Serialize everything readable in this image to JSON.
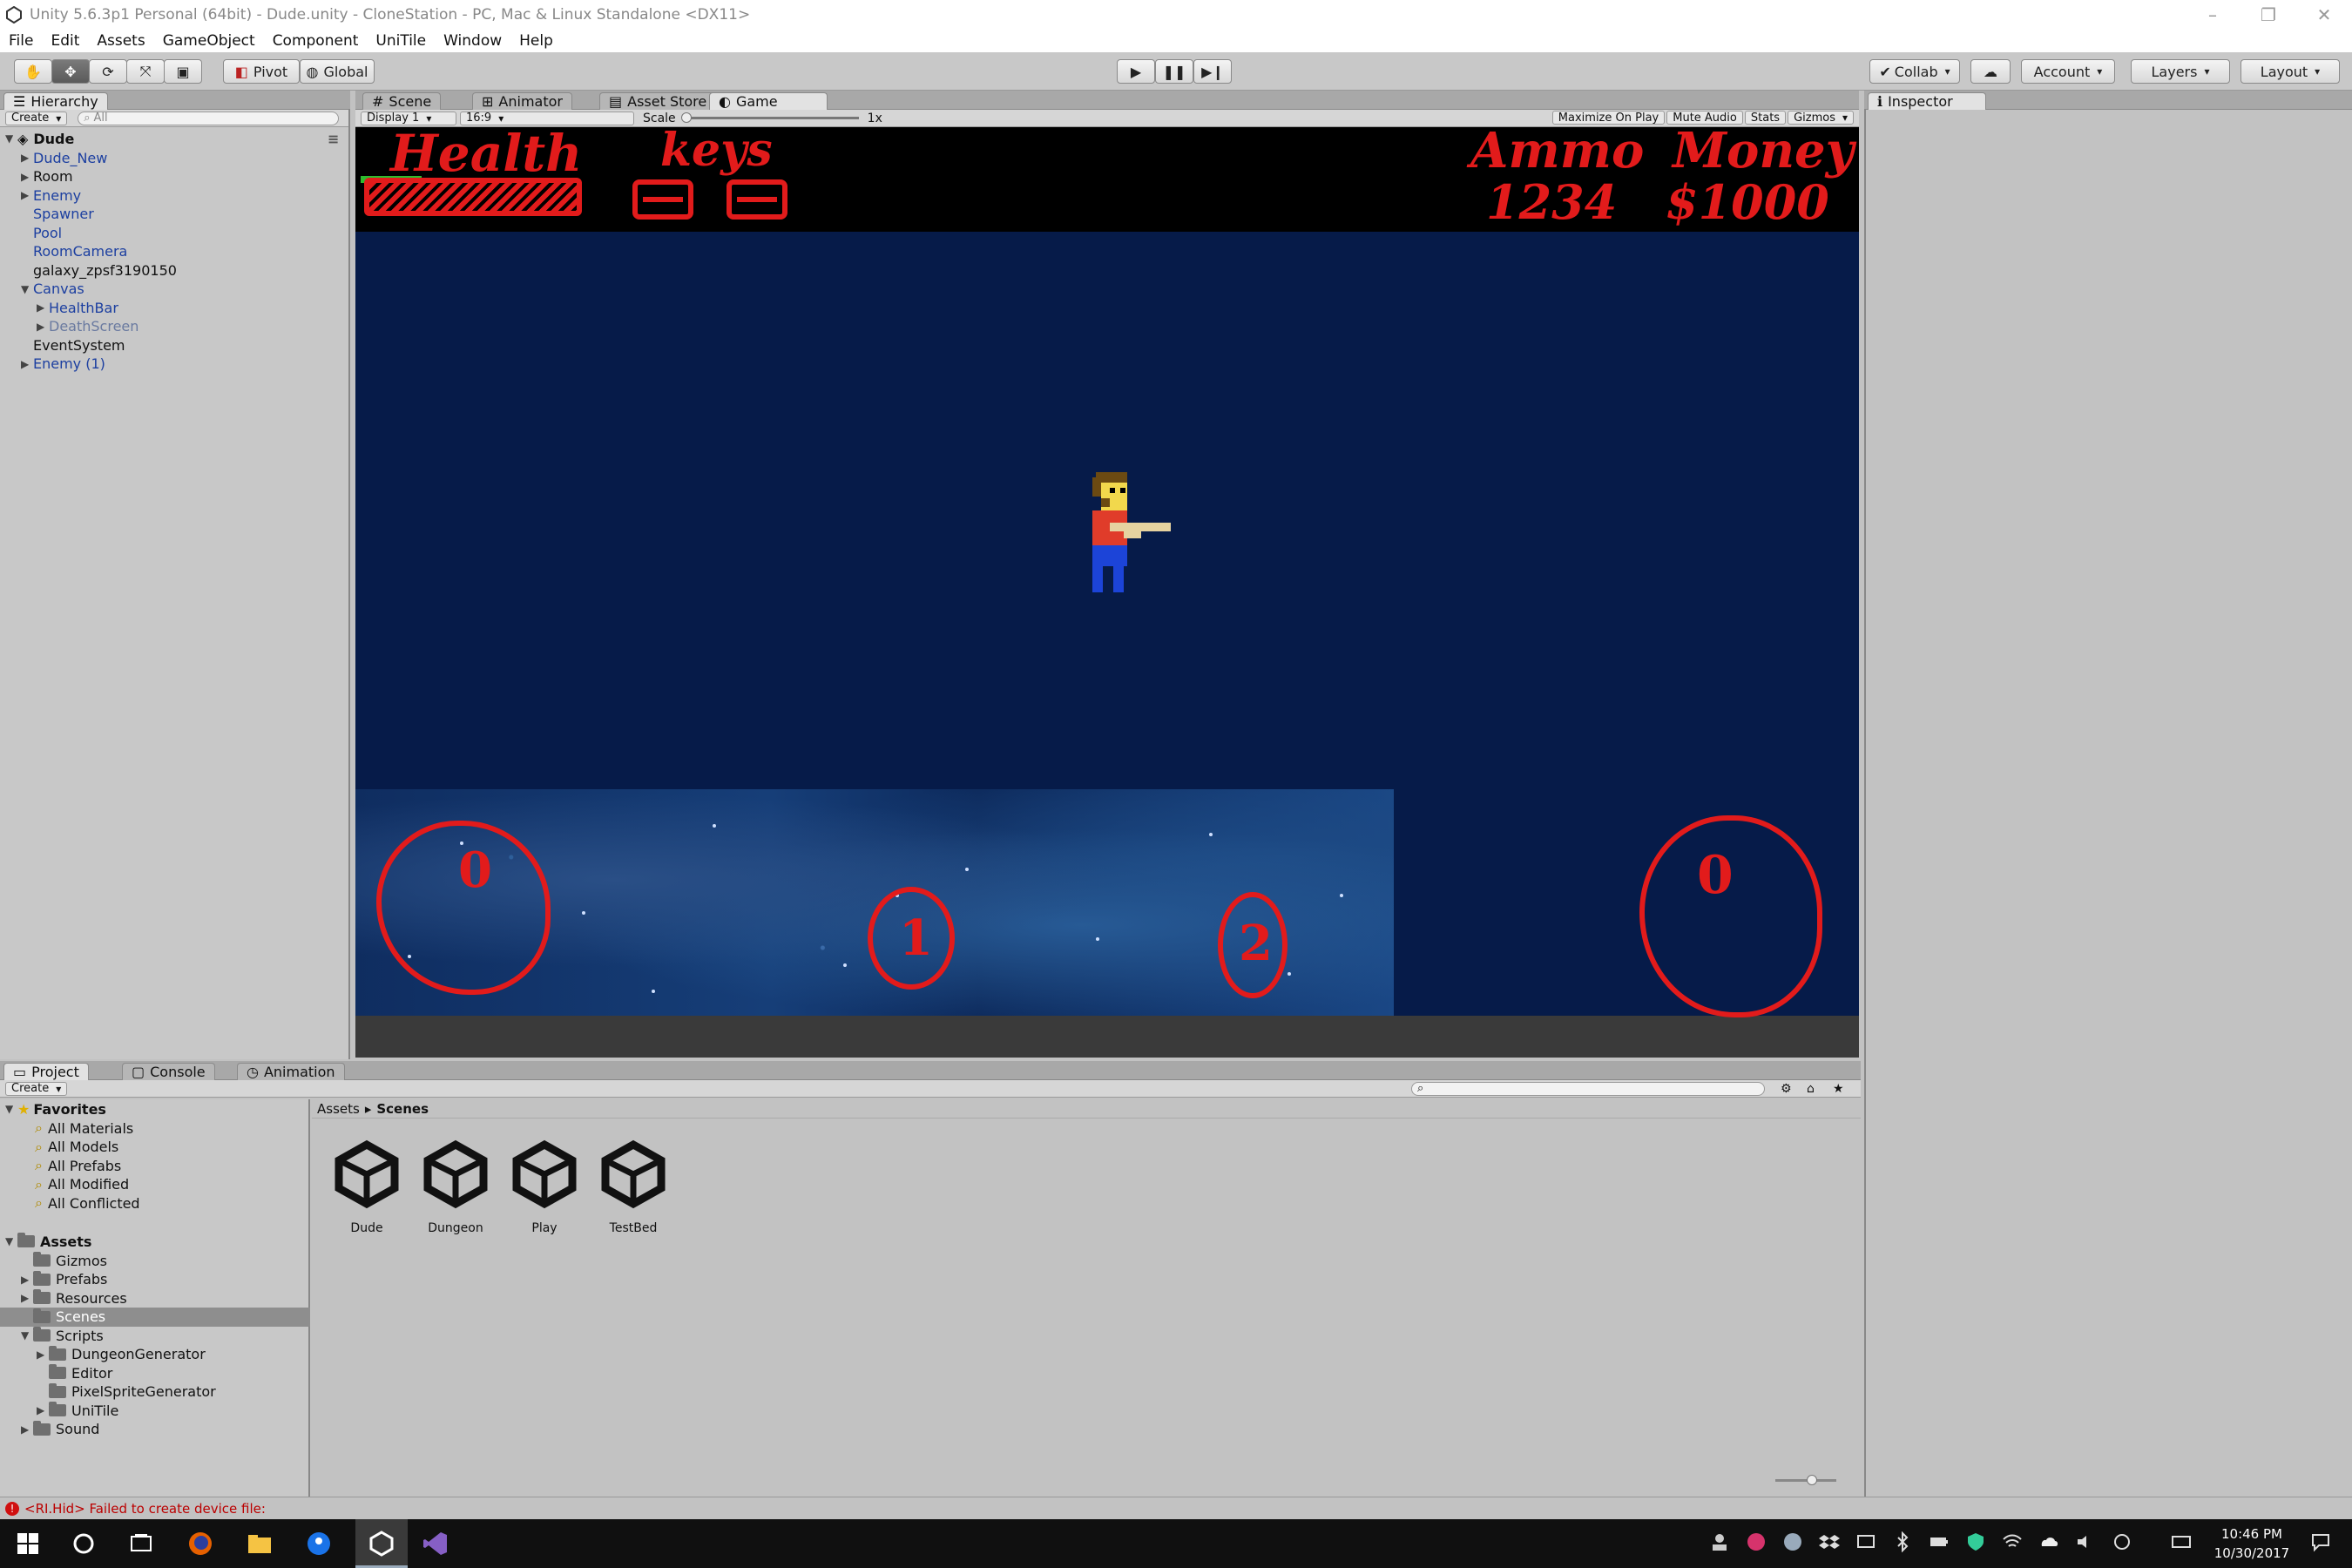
{
  "window": {
    "title": "Unity 5.6.3p1 Personal (64bit) - Dude.unity - CloneStation - PC, Mac & Linux Standalone <DX11>",
    "controls": [
      "–",
      "❐",
      "✕"
    ]
  },
  "menu": [
    "File",
    "Edit",
    "Assets",
    "GameObject",
    "Component",
    "UniTile",
    "Window",
    "Help"
  ],
  "toolbar": {
    "pivot": "Pivot",
    "global": "Global",
    "collab": "Collab",
    "account": "Account",
    "layers": "Layers",
    "layout": "Layout"
  },
  "hierarchy": {
    "tab": "Hierarchy",
    "create": "Create",
    "search_placeholder": "All",
    "scene": "Dude",
    "items": [
      {
        "label": "Dude_New",
        "arrow": "▶",
        "level": 1,
        "style": "blue"
      },
      {
        "label": "Room",
        "arrow": "▶",
        "level": 1,
        "style": ""
      },
      {
        "label": "Enemy",
        "arrow": "▶",
        "level": 1,
        "style": "blue"
      },
      {
        "label": "Spawner",
        "arrow": "",
        "level": 1,
        "style": "blue"
      },
      {
        "label": "Pool",
        "arrow": "",
        "level": 1,
        "style": "blue"
      },
      {
        "label": "RoomCamera",
        "arrow": "",
        "level": 1,
        "style": "blue"
      },
      {
        "label": "galaxy_zpsf3190150",
        "arrow": "",
        "level": 1,
        "style": ""
      },
      {
        "label": "Canvas",
        "arrow": "▼",
        "level": 1,
        "style": "blue"
      },
      {
        "label": "HealthBar",
        "arrow": "▶",
        "level": 2,
        "style": "blue"
      },
      {
        "label": "DeathScreen",
        "arrow": "▶",
        "level": 2,
        "style": "muted"
      },
      {
        "label": "EventSystem",
        "arrow": "",
        "level": 1,
        "style": ""
      },
      {
        "label": "Enemy (1)",
        "arrow": "▶",
        "level": 1,
        "style": "blue"
      }
    ]
  },
  "center_tabs": {
    "scene": "Scene",
    "animator": "Animator",
    "asset_store": "Asset Store",
    "game": "Game"
  },
  "game_bar": {
    "display": "Display 1",
    "aspect": "16:9",
    "scale_label": "Scale",
    "scale_value": "1x",
    "maximize": "Maximize On Play",
    "mute": "Mute Audio",
    "stats": "Stats",
    "gizmos": "Gizmos"
  },
  "annotations": {
    "health": "Health",
    "keys": "keys",
    "ammo": "Ammo",
    "ammo_value": "1234",
    "money": "Money",
    "money_value": "$1000",
    "circle_0": "0",
    "circle_1": "1",
    "circle_2": "2",
    "circle_3": "0"
  },
  "inspector": {
    "tab": "Inspector"
  },
  "bottom_tabs": {
    "project": "Project",
    "console": "Console",
    "animation": "Animation",
    "create": "Create"
  },
  "project_tree": {
    "favorites": "Favorites",
    "favorite_items": [
      "All Materials",
      "All Models",
      "All Prefabs",
      "All Modified",
      "All Conflicted"
    ],
    "assets": "Assets",
    "folders": [
      {
        "label": "Gizmos",
        "arrow": "",
        "level": 1
      },
      {
        "label": "Prefabs",
        "arrow": "▶",
        "level": 1
      },
      {
        "label": "Resources",
        "arrow": "▶",
        "level": 1
      },
      {
        "label": "Scenes",
        "arrow": "",
        "level": 1,
        "selected": true
      },
      {
        "label": "Scripts",
        "arrow": "▼",
        "level": 1
      },
      {
        "label": "DungeonGenerator",
        "arrow": "▶",
        "level": 2
      },
      {
        "label": "Editor",
        "arrow": "",
        "level": 2
      },
      {
        "label": "PixelSpriteGenerator",
        "arrow": "",
        "level": 2
      },
      {
        "label": "UniTile",
        "arrow": "▶",
        "level": 2
      },
      {
        "label": "Sound",
        "arrow": "▶",
        "level": 1
      }
    ]
  },
  "breadcrumb": {
    "root": "Assets",
    "sep": "▸",
    "current": "Scenes"
  },
  "scenes": [
    "Dude",
    "Dungeon",
    "Play",
    "TestBed"
  ],
  "status": {
    "message": "<RI.Hid> Failed to create device file:"
  },
  "clock": {
    "time": "10:46 PM",
    "date": "10/30/2017"
  },
  "colors": {
    "accent_red": "#e21b1b",
    "game_sky": "#061b49",
    "selection": "#8e8e8e"
  }
}
